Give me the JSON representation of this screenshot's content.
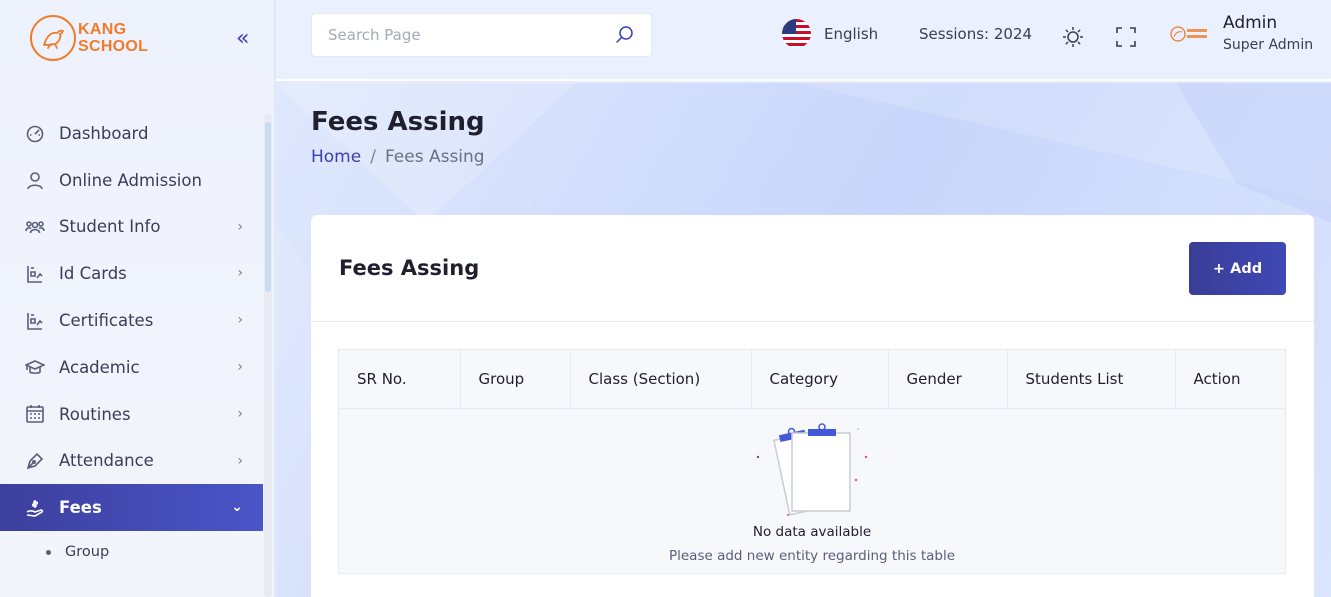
{
  "brand": {
    "line1": "KANG",
    "line2": "SCHOOL",
    "color": "#f07b2a"
  },
  "sidebar": {
    "collapse_glyph": "«",
    "items": [
      {
        "label": "Dashboard",
        "icon": "dashboard-icon",
        "chevron": ""
      },
      {
        "label": "Online Admission",
        "icon": "user-icon",
        "chevron": ""
      },
      {
        "label": "Student Info",
        "icon": "students-icon",
        "chevron": "›"
      },
      {
        "label": "Id Cards",
        "icon": "id-card-icon",
        "chevron": "›"
      },
      {
        "label": "Certificates",
        "icon": "certificate-icon",
        "chevron": "›"
      },
      {
        "label": "Academic",
        "icon": "graduation-cap-icon",
        "chevron": "›"
      },
      {
        "label": "Routines",
        "icon": "calendar-icon",
        "chevron": "›"
      },
      {
        "label": "Attendance",
        "icon": "pen-icon",
        "chevron": "›"
      },
      {
        "label": "Fees",
        "icon": "fees-icon",
        "chevron": "⌄",
        "active": true
      }
    ],
    "sub_items": [
      {
        "label": "Group"
      }
    ]
  },
  "topbar": {
    "search_placeholder": "Search Page",
    "language": "English",
    "sessions": "Sessions: 2024",
    "user_name": "Admin",
    "user_role": "Super Admin"
  },
  "page": {
    "title": "Fees Assing",
    "breadcrumb_home": "Home",
    "breadcrumb_sep": "/",
    "breadcrumb_current": "Fees Assing"
  },
  "card": {
    "title": "Fees Assing",
    "add_label": "+ Add",
    "columns": [
      "SR No.",
      "Group",
      "Class (Section)",
      "Category",
      "Gender",
      "Students List",
      "Action"
    ],
    "empty_title": "No data available",
    "empty_subtitle": "Please add new entity regarding this table"
  },
  "colors": {
    "accent": "#3b3fb0",
    "active_nav": "#3c3f9c"
  }
}
